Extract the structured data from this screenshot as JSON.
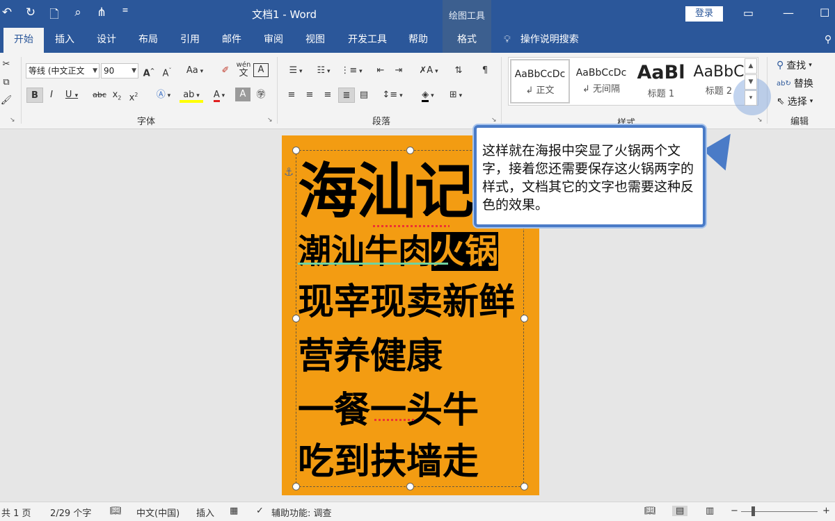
{
  "window": {
    "title": "文档1  -  Word",
    "contextual_group": "绘图工具",
    "login_label": "登录"
  },
  "qat": {
    "undo_icon": "undo-icon",
    "redo_icon": "redo-icon",
    "new_icon": "new-doc-icon",
    "preview_icon": "print-preview-icon",
    "tree_icon": "org-chart-icon",
    "customize_icon": "customize-qat-icon"
  },
  "tabs": [
    {
      "label": "开始",
      "active": true
    },
    {
      "label": "插入"
    },
    {
      "label": "设计"
    },
    {
      "label": "布局"
    },
    {
      "label": "引用"
    },
    {
      "label": "邮件"
    },
    {
      "label": "审阅"
    },
    {
      "label": "视图"
    },
    {
      "label": "开发工具"
    },
    {
      "label": "帮助"
    },
    {
      "label": "格式"
    }
  ],
  "tellme": "操作说明搜索",
  "font": {
    "name": "等线 (中文正文",
    "size": "90",
    "group_label": "字体",
    "change_case": "Aa",
    "pinyin": "wén"
  },
  "paragraph": {
    "group_label": "段落"
  },
  "styles": {
    "group_label": "样式",
    "items": [
      {
        "sample": "AaBbCcDc",
        "name": "↲ 正文"
      },
      {
        "sample": "AaBbCcDc",
        "name": "↲ 无间隔"
      },
      {
        "sample": "AaBl",
        "name": "标题 1"
      },
      {
        "sample": "AaBbC",
        "name": "标题 2"
      }
    ]
  },
  "editing": {
    "group_label": "编辑",
    "find": "查找",
    "replace": "替换",
    "select": "选择"
  },
  "poster": {
    "title": "海汕记",
    "line2_normal": "潮汕牛肉",
    "line2_inverted": "火锅",
    "line3": "现宰现卖新鲜",
    "line4": "营养健康",
    "line5": "一餐一头牛",
    "line6": "吃到扶墙走"
  },
  "callout": {
    "text": "这样就在海报中突显了火锅两个文字，接着您还需要保存这火锅两字的样式，文档其它的文字也需要这种反色的效果。"
  },
  "status": {
    "pages": "共 1 页",
    "words": "2/29 个字",
    "language": "中文(中国)",
    "mode": "插入",
    "accessibility": "辅助功能: 调查"
  },
  "colors": {
    "accent": "#2b579a",
    "poster_bg": "#f39c12",
    "callout_border": "#4a7bc7"
  }
}
